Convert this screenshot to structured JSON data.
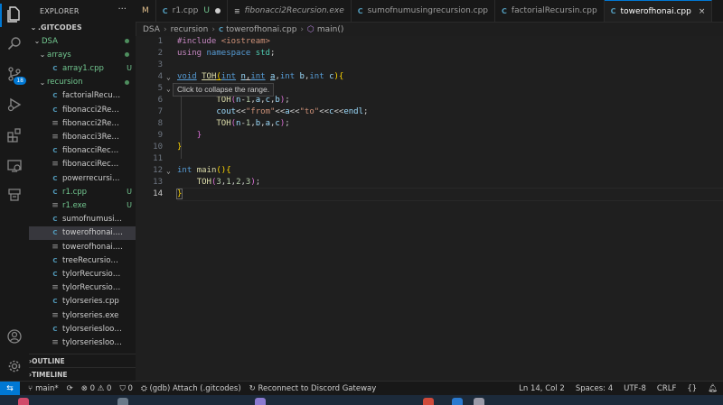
{
  "colors": {
    "accent": "#0078d4",
    "untracked": "#73c991",
    "keyword": "#569cd6",
    "string": "#ce9178",
    "function": "#dcdcaa"
  },
  "activity_bar": {
    "icons": [
      "files-icon",
      "search-icon",
      "source-control-icon",
      "run-debug-icon",
      "extensions-icon",
      "remote-explorer-icon",
      "testing-icon",
      "account-icon",
      "settings-gear-icon"
    ],
    "source_control_badge": "18"
  },
  "explorer": {
    "title": "EXPLORER",
    "more": "···",
    "root": ".GITCODES",
    "items": [
      {
        "label": "DSA",
        "kind": "folder",
        "open": true,
        "depth": 1,
        "status": "dot"
      },
      {
        "label": "arrays",
        "kind": "folder",
        "open": true,
        "depth": 2,
        "status": "dot"
      },
      {
        "label": "array1.cpp",
        "kind": "cpp",
        "depth": 3,
        "status": "U"
      },
      {
        "label": "recursion",
        "kind": "folder",
        "open": true,
        "depth": 2,
        "status": "dot"
      },
      {
        "label": "factorialRecursin.cpp",
        "kind": "cpp",
        "depth": 3,
        "status": ""
      },
      {
        "label": "fibonacci2Recursio...",
        "kind": "cpp",
        "depth": 3,
        "status": ""
      },
      {
        "label": "fibonacci2Recursio...",
        "kind": "exe",
        "depth": 3,
        "status": ""
      },
      {
        "label": "fibonacci3Recursio...",
        "kind": "exe",
        "depth": 3,
        "status": ""
      },
      {
        "label": "fibonacciRecursion...",
        "kind": "cpp",
        "depth": 3,
        "status": ""
      },
      {
        "label": "fibonacciRecursion...",
        "kind": "exe",
        "depth": 3,
        "status": ""
      },
      {
        "label": "powerrecursion.cpp",
        "kind": "cpp",
        "depth": 3,
        "status": ""
      },
      {
        "label": "r1.cpp",
        "kind": "cpp",
        "depth": 3,
        "status": "U"
      },
      {
        "label": "r1.exe",
        "kind": "exe",
        "depth": 3,
        "status": "U"
      },
      {
        "label": "sumofnumusingre...",
        "kind": "cpp",
        "depth": 3,
        "status": ""
      },
      {
        "label": "towerofhonai.cpp",
        "kind": "cpp",
        "depth": 3,
        "status": "",
        "selected": true
      },
      {
        "label": "towerofhonai.exe",
        "kind": "exe",
        "depth": 3,
        "status": ""
      },
      {
        "label": "treeRecursion.cpp",
        "kind": "cpp",
        "depth": 3,
        "status": ""
      },
      {
        "label": "tylorRecursionSin.c...",
        "kind": "cpp",
        "depth": 3,
        "status": ""
      },
      {
        "label": "tylorRecursionSin.e...",
        "kind": "exe",
        "depth": 3,
        "status": ""
      },
      {
        "label": "tylorseries.cpp",
        "kind": "cpp",
        "depth": 3,
        "status": ""
      },
      {
        "label": "tylorseries.exe",
        "kind": "exe",
        "depth": 3,
        "status": ""
      },
      {
        "label": "tylorseriesloop.cpp",
        "kind": "cpp",
        "depth": 3,
        "status": ""
      },
      {
        "label": "tylorseriesloop.exe",
        "kind": "exe",
        "depth": 3,
        "status": ""
      }
    ],
    "outline": "OUTLINE",
    "timeline": "TIMELINE"
  },
  "tabs": [
    {
      "label": "",
      "suffix": "M",
      "kind": "none"
    },
    {
      "label": "r1.cpp",
      "suffix": "U",
      "kind": "cpp",
      "dirty": true
    },
    {
      "label": "fibonacci2Recursion.exe",
      "kind": "exe",
      "italic": true
    },
    {
      "label": "sumofnumusingrecursion.cpp",
      "kind": "cpp"
    },
    {
      "label": "factorialRecursin.cpp",
      "kind": "cpp"
    },
    {
      "label": "towerofhonai.cpp",
      "kind": "cpp",
      "active": true,
      "close": "×"
    }
  ],
  "breadcrumb": {
    "parts": [
      "DSA",
      "recursion",
      "towerofhonai.cpp",
      "main()"
    ]
  },
  "editor": {
    "current_line": 14,
    "hover_tooltip": "Click to collapse the range.",
    "lines": [
      {
        "n": "1",
        "html": "<span class='kp'>#include</span> <span class='s'>&lt;iostream&gt;</span>"
      },
      {
        "n": "2",
        "html": "<span class='kp'>using</span> <span class='k'>namespace</span> <span class='ty'>std</span><span class='p'>;</span>"
      },
      {
        "n": "3",
        "html": ""
      },
      {
        "n": "4",
        "fold": "⌄",
        "html": "<span class='k ul'>void</span> <span class='fn ul'>TOH</span><span class='b1 ul'>(</span><span class='k ul'>int</span> <span class='v ul'>n</span><span class='p ul'>,</span><span class='k ul'>int</span> <span class='v ul'>a</span><span class='p'>,</span><span class='k'>int</span> <span class='v'>b</span><span class='p'>,</span><span class='k'>int</span> <span class='v'>c</span><span class='b1'>)</span><span class='b1'>{</span>"
      },
      {
        "n": "5",
        "fold": "⌄",
        "html": ""
      },
      {
        "n": "6",
        "html": "        <span class='fn'>TOH</span><span class='b2'>(</span><span class='v'>n</span><span class='p'>-</span><span class='n'>1</span><span class='p'>,</span><span class='v'>a</span><span class='p'>,</span><span class='v'>c</span><span class='p'>,</span><span class='v'>b</span><span class='b2'>)</span><span class='p'>;</span>"
      },
      {
        "n": "7",
        "html": "        <span class='v'>cout</span><span class='p'>&lt;&lt;</span><span class='s'>\"from\"</span><span class='p'>&lt;&lt;</span><span class='v'>a</span><span class='p'>&lt;&lt;</span><span class='s'>\"to\"</span><span class='p'>&lt;&lt;</span><span class='v'>c</span><span class='p'>&lt;&lt;</span><span class='v'>endl</span><span class='p'>;</span>"
      },
      {
        "n": "8",
        "html": "        <span class='fn'>TOH</span><span class='b2'>(</span><span class='v'>n</span><span class='p'>-</span><span class='n'>1</span><span class='p'>,</span><span class='v'>b</span><span class='p'>,</span><span class='v'>a</span><span class='p'>,</span><span class='v'>c</span><span class='b2'>)</span><span class='p'>;</span>"
      },
      {
        "n": "9",
        "html": "    <span class='b2'>}</span>"
      },
      {
        "n": "10",
        "html": "<span class='b1'>}</span>"
      },
      {
        "n": "11",
        "html": ""
      },
      {
        "n": "12",
        "fold": "⌄",
        "html": "<span class='k'>int</span> <span class='fn'>main</span><span class='b1'>()</span><span class='b1'>{</span>"
      },
      {
        "n": "13",
        "html": "    <span class='fn'>TOH</span><span class='b2'>(</span><span class='n'>3</span><span class='p'>,</span><span class='n'>1</span><span class='p'>,</span><span class='n'>2</span><span class='p'>,</span><span class='n'>3</span><span class='b2'>)</span><span class='p'>;</span>"
      },
      {
        "n": "14",
        "html": "<span class='b1' style='outline:1px solid #666'>}</span>"
      }
    ]
  },
  "statusbar": {
    "remote_icon": "remote-icon",
    "branch": "main*",
    "sync_icon": "sync-icon",
    "errors": "0",
    "warnings": "0",
    "ports": "0",
    "debug": "(gdb) Attach (.gitcodes)",
    "discord": "Reconnect to Discord Gateway",
    "position": "Ln 14, Col 2",
    "spaces": "Spaces: 4",
    "encoding": "UTF-8",
    "eol": "CRLF",
    "language_brace": "{}",
    "bell_icon": "bell-icon"
  }
}
